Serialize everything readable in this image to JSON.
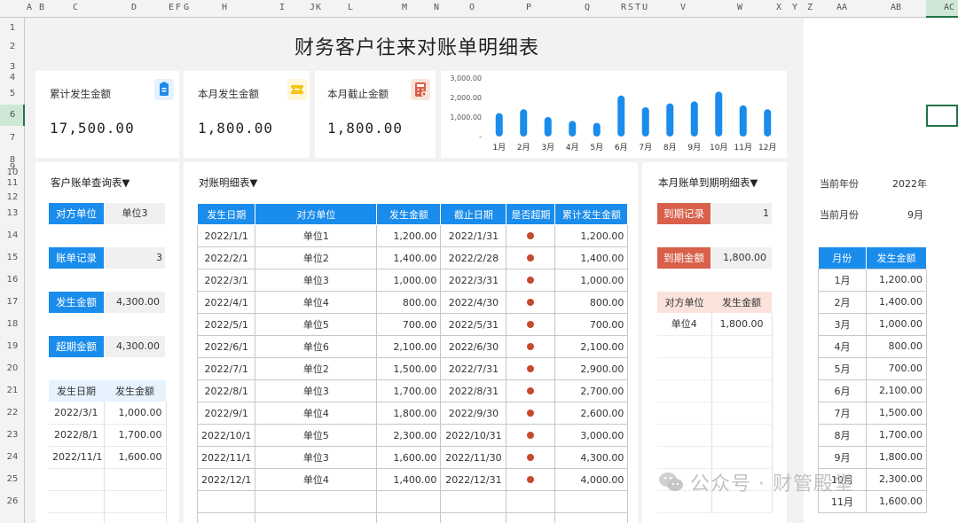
{
  "col_headers": [
    "A",
    "B",
    "C",
    "D",
    "E",
    "F",
    "G",
    "H",
    "I",
    "J",
    "K",
    "L",
    "M",
    "N",
    "O",
    "P",
    "Q",
    "R",
    "S",
    "T",
    "U",
    "V",
    "W",
    "X",
    "Y",
    "Z",
    "AA",
    "AB",
    "AC"
  ],
  "row_headers": [
    "1",
    "2",
    "3",
    "4",
    "5",
    "6",
    "7",
    "8",
    "9",
    "10",
    "11",
    "12",
    "13",
    "14",
    "15",
    "16",
    "17",
    "18",
    "19",
    "20",
    "21",
    "22",
    "23",
    "24",
    "25",
    "26"
  ],
  "title": "财务客户往来对账单明细表",
  "cards": [
    {
      "label": "累计发生金额",
      "value": "17,500.00",
      "icon": "clipboard-icon",
      "icon_color": "#1a8cec"
    },
    {
      "label": "本月发生金额",
      "value": "1,800.00",
      "icon": "ticket-icon",
      "icon_color": "#f5c518"
    },
    {
      "label": "本月截止金额",
      "value": "1,800.00",
      "icon": "calculator-icon",
      "icon_color": "#d9604a"
    }
  ],
  "chart_data": {
    "type": "bar",
    "categories": [
      "1月",
      "2月",
      "3月",
      "4月",
      "5月",
      "6月",
      "7月",
      "8月",
      "9月",
      "10月",
      "11月",
      "12月"
    ],
    "values": [
      1200,
      1400,
      1000,
      800,
      700,
      2100,
      1500,
      1700,
      1800,
      2300,
      1600,
      1400
    ],
    "yticks": [
      "3,000.00",
      "2,000.00",
      "1,000.00",
      "-"
    ],
    "ylim": [
      0,
      3000
    ],
    "color": "#1a8cec"
  },
  "left_panel": {
    "dropdown": "客户账单查询表▼",
    "fields": [
      {
        "label": "对方单位",
        "value": "单位3"
      },
      {
        "label": "账单记录",
        "value": "3"
      },
      {
        "label": "发生金额",
        "value": "4,300.00"
      },
      {
        "label": "超期金额",
        "value": "4,300.00"
      }
    ],
    "table_headers": [
      "发生日期",
      "发生金额"
    ],
    "rows": [
      [
        "2022/3/1",
        "1,000.00"
      ],
      [
        "2022/8/1",
        "1,700.00"
      ],
      [
        "2022/11/1",
        "1,600.00"
      ]
    ]
  },
  "main_panel": {
    "dropdown": "对账明细表▼",
    "headers": [
      "发生日期",
      "对方单位",
      "发生金额",
      "截止日期",
      "是否超期",
      "累计发生金额"
    ],
    "rows": [
      [
        "2022/1/1",
        "单位1",
        "1,200.00",
        "2022/1/31",
        "1,200.00"
      ],
      [
        "2022/2/1",
        "单位2",
        "1,400.00",
        "2022/2/28",
        "1,400.00"
      ],
      [
        "2022/3/1",
        "单位3",
        "1,000.00",
        "2022/3/31",
        "1,000.00"
      ],
      [
        "2022/4/1",
        "单位4",
        "800.00",
        "2022/4/30",
        "800.00"
      ],
      [
        "2022/5/1",
        "单位5",
        "700.00",
        "2022/5/31",
        "700.00"
      ],
      [
        "2022/6/1",
        "单位6",
        "2,100.00",
        "2022/6/30",
        "2,100.00"
      ],
      [
        "2022/7/1",
        "单位2",
        "1,500.00",
        "2022/7/31",
        "2,900.00"
      ],
      [
        "2022/8/1",
        "单位3",
        "1,700.00",
        "2022/8/31",
        "2,700.00"
      ],
      [
        "2022/9/1",
        "单位4",
        "1,800.00",
        "2022/9/30",
        "2,600.00"
      ],
      [
        "2022/10/1",
        "单位5",
        "2,300.00",
        "2022/10/31",
        "3,000.00"
      ],
      [
        "2022/11/1",
        "单位3",
        "1,600.00",
        "2022/11/30",
        "4,300.00"
      ],
      [
        "2022/12/1",
        "单位4",
        "1,400.00",
        "2022/12/31",
        "4,000.00"
      ]
    ]
  },
  "period_panel": {
    "dropdown": "本月账单到期明细表▼",
    "fields": [
      {
        "label": "到期记录",
        "value": "1"
      },
      {
        "label": "到期金额",
        "value": "1,800.00"
      }
    ],
    "table_headers": [
      "对方单位",
      "发生金额"
    ],
    "rows": [
      [
        "单位4",
        "1,800.00"
      ]
    ]
  },
  "right_panel": {
    "year_label": "当前年份",
    "year_value": "2022年",
    "month_label": "当前月份",
    "month_value": "9月",
    "table_headers": [
      "月份",
      "发生金额"
    ],
    "rows": [
      [
        "1月",
        "1,200.00"
      ],
      [
        "2月",
        "1,400.00"
      ],
      [
        "3月",
        "1,000.00"
      ],
      [
        "4月",
        "800.00"
      ],
      [
        "5月",
        "700.00"
      ],
      [
        "6月",
        "2,100.00"
      ],
      [
        "7月",
        "1,500.00"
      ],
      [
        "8月",
        "1,700.00"
      ],
      [
        "9月",
        "1,800.00"
      ],
      [
        "10月",
        "2,300.00"
      ],
      [
        "11月",
        "1,600.00"
      ]
    ]
  },
  "watermark": "公众号 · 财管殿堂"
}
